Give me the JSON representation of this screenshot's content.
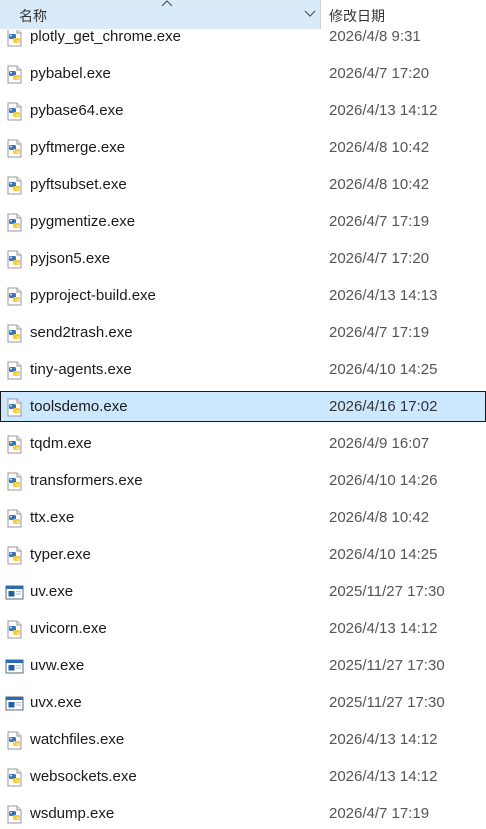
{
  "header": {
    "name_label": "名称",
    "date_label": "修改日期"
  },
  "colors": {
    "selection_bg": "#cce8ff",
    "header_hover_bg": "#d9ebf9",
    "python_blue": "#3b73b9",
    "python_yellow": "#f7cd3c"
  },
  "files": [
    {
      "name": "plotly_get_chrome.exe",
      "date": "2026/4/8 9:31",
      "icon": "python-exe-icon"
    },
    {
      "name": "pybabel.exe",
      "date": "2026/4/7 17:20",
      "icon": "python-exe-icon"
    },
    {
      "name": "pybase64.exe",
      "date": "2026/4/13 14:12",
      "icon": "python-exe-icon"
    },
    {
      "name": "pyftmerge.exe",
      "date": "2026/4/8 10:42",
      "icon": "python-exe-icon"
    },
    {
      "name": "pyftsubset.exe",
      "date": "2026/4/8 10:42",
      "icon": "python-exe-icon"
    },
    {
      "name": "pygmentize.exe",
      "date": "2026/4/7 17:19",
      "icon": "python-exe-icon"
    },
    {
      "name": "pyjson5.exe",
      "date": "2026/4/7 17:20",
      "icon": "python-exe-icon"
    },
    {
      "name": "pyproject-build.exe",
      "date": "2026/4/13 14:13",
      "icon": "python-exe-icon"
    },
    {
      "name": "send2trash.exe",
      "date": "2026/4/7 17:19",
      "icon": "python-exe-icon"
    },
    {
      "name": "tiny-agents.exe",
      "date": "2026/4/10 14:25",
      "icon": "python-exe-icon"
    },
    {
      "name": "toolsdemo.exe",
      "date": "2026/4/16 17:02",
      "icon": "python-exe-icon",
      "selected": true
    },
    {
      "name": "tqdm.exe",
      "date": "2026/4/9 16:07",
      "icon": "python-exe-icon"
    },
    {
      "name": "transformers.exe",
      "date": "2026/4/10 14:26",
      "icon": "python-exe-icon"
    },
    {
      "name": "ttx.exe",
      "date": "2026/4/8 10:42",
      "icon": "python-exe-icon"
    },
    {
      "name": "typer.exe",
      "date": "2026/4/10 14:25",
      "icon": "python-exe-icon"
    },
    {
      "name": "uv.exe",
      "date": "2025/11/27 17:30",
      "icon": "window-exe-icon"
    },
    {
      "name": "uvicorn.exe",
      "date": "2026/4/13 14:12",
      "icon": "python-exe-icon"
    },
    {
      "name": "uvw.exe",
      "date": "2025/11/27 17:30",
      "icon": "window-exe-icon"
    },
    {
      "name": "uvx.exe",
      "date": "2025/11/27 17:30",
      "icon": "window-exe-icon"
    },
    {
      "name": "watchfiles.exe",
      "date": "2026/4/13 14:12",
      "icon": "python-exe-icon"
    },
    {
      "name": "websockets.exe",
      "date": "2026/4/13 14:12",
      "icon": "python-exe-icon"
    },
    {
      "name": "wsdump.exe",
      "date": "2026/4/7 17:19",
      "icon": "python-exe-icon"
    }
  ]
}
